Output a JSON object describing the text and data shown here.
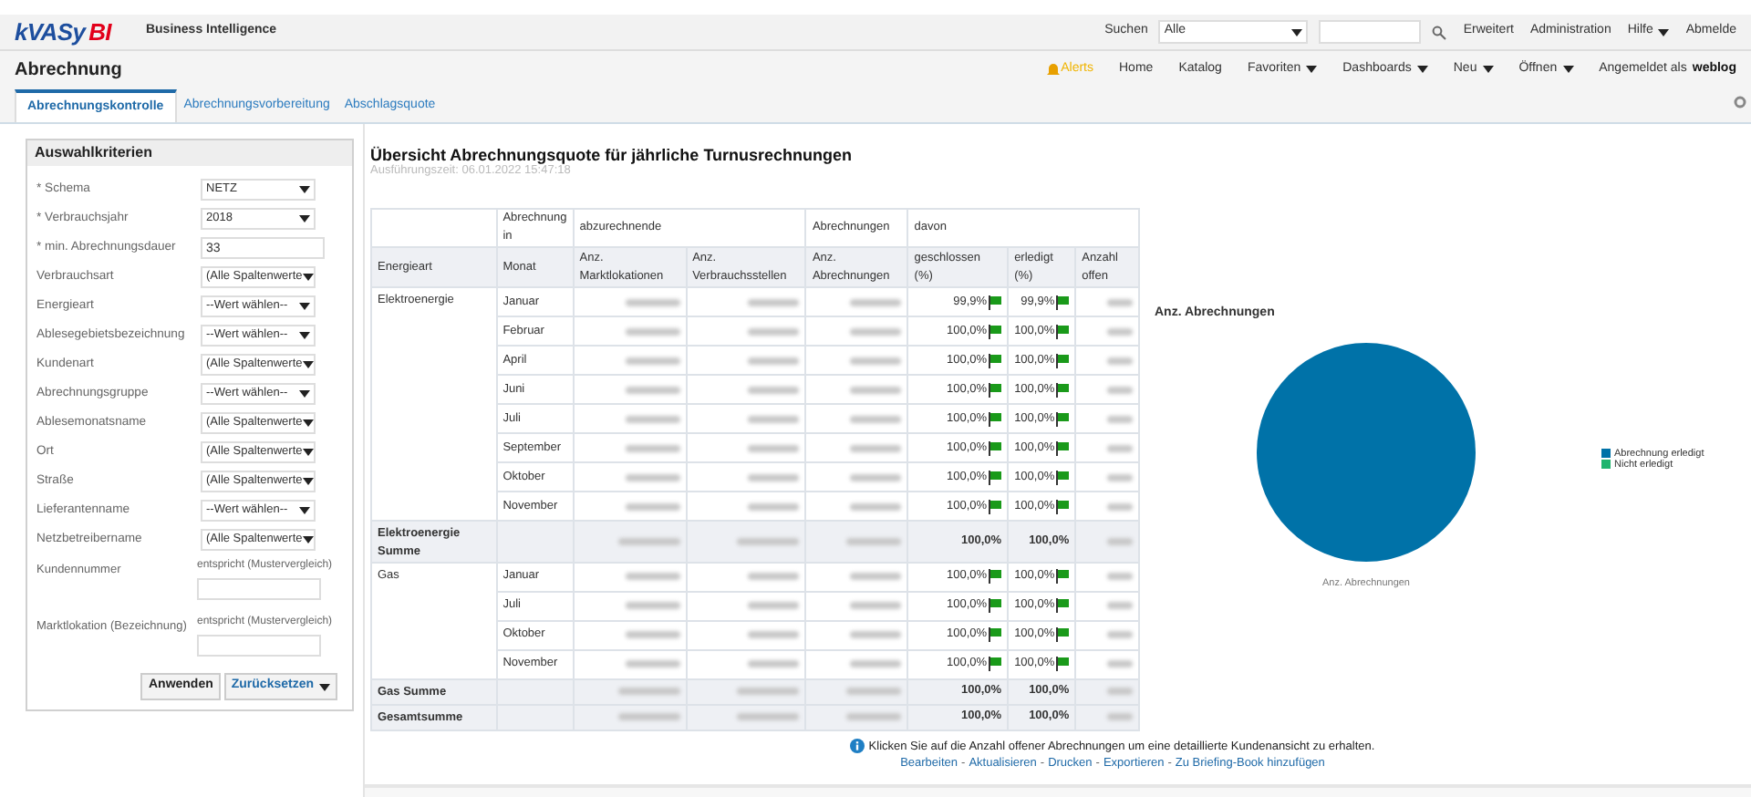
{
  "header": {
    "logo_primary": "kVASy",
    "logo_accent": "BI",
    "app_title": "Business Intelligence",
    "search": {
      "label": "Suchen",
      "scope": "Alle"
    },
    "links": [
      {
        "label": "Erweitert",
        "dropdown": false
      },
      {
        "label": "Administration",
        "dropdown": false
      },
      {
        "label": "Hilfe",
        "dropdown": true
      },
      {
        "label": "Abmelde",
        "dropdown": false
      }
    ]
  },
  "navbar": {
    "page_title": "Abrechnung",
    "alerts": "Alerts",
    "items": [
      {
        "label": "Home",
        "dropdown": false
      },
      {
        "label": "Katalog",
        "dropdown": false
      },
      {
        "label": "Favoriten",
        "dropdown": true
      },
      {
        "label": "Dashboards",
        "dropdown": true
      },
      {
        "label": "Neu",
        "dropdown": true
      },
      {
        "label": "Öffnen",
        "dropdown": true
      }
    ],
    "signed_in_label": "Angemeldet als",
    "user": "weblog"
  },
  "tabs": [
    {
      "label": "Abrechnungskontrolle",
      "selected": true
    },
    {
      "label": "Abrechnungsvorbereitung",
      "selected": false
    },
    {
      "label": "Abschlagsquote",
      "selected": false
    }
  ],
  "criteria": {
    "title": "Auswahlkriterien",
    "fields": [
      {
        "kind": "select",
        "label": "* Schema",
        "value": "NETZ"
      },
      {
        "kind": "select",
        "label": "* Verbrauchsjahr",
        "value": "2018"
      },
      {
        "kind": "text",
        "label": "* min. Abrechnungsdauer",
        "value": "33"
      },
      {
        "kind": "select",
        "label": "Verbrauchsart",
        "value": "(Alle Spaltenwerte"
      },
      {
        "kind": "select",
        "label": "Energieart",
        "value": "--Wert wählen--"
      },
      {
        "kind": "select",
        "label": "Ablesegebietsbezeichnung",
        "value": "--Wert wählen--"
      },
      {
        "kind": "select",
        "label": "Kundenart",
        "value": "(Alle Spaltenwerte"
      },
      {
        "kind": "select",
        "label": "Abrechnungsgruppe",
        "value": "--Wert wählen--"
      },
      {
        "kind": "select",
        "label": "Ablesemonatsname",
        "value": "(Alle Spaltenwerte"
      },
      {
        "kind": "select",
        "label": "Ort",
        "value": "(Alle Spaltenwerte"
      },
      {
        "kind": "select",
        "label": "Straße",
        "value": "(Alle Spaltenwerte"
      },
      {
        "kind": "select",
        "label": "Lieferantenname",
        "value": "--Wert wählen--"
      },
      {
        "kind": "select",
        "label": "Netzbetreibername",
        "value": "(Alle Spaltenwerte"
      },
      {
        "kind": "pattern",
        "label": "Kundennummer",
        "operator": "entspricht (Mustervergleich)"
      },
      {
        "kind": "pattern",
        "label": "Marktlokation (Bezeichnung)",
        "operator": "entspricht (Mustervergleich)"
      }
    ],
    "buttons": [
      {
        "label": "Anwenden",
        "dropdown": false
      },
      {
        "label": "Zurücksetzen",
        "dropdown": true
      }
    ]
  },
  "report": {
    "title": "Übersicht Abrechnungsquote für jährliche Turnusrechnungen",
    "timestamp": "Ausführungszeit: 06.01.2022 15:47:18",
    "group_headers": [
      "Abrechnung in",
      "abzurechnende",
      "Abrechnungen",
      "davon"
    ],
    "columns": [
      "Energieart",
      "Monat",
      "Anz. Marktlokationen",
      "Anz. Verbrauchsstellen",
      "Anz. Abrechnungen",
      "geschlossen (%)",
      "erledigt (%)",
      "Anzahl offen"
    ],
    "rows": [
      {
        "kind": "data",
        "energieart": "Elektroenergie",
        "monat": "Januar",
        "geschlossen": "99,9%",
        "erledigt": "99,9%",
        "flag": true
      },
      {
        "kind": "data",
        "monat": "Februar",
        "geschlossen": "100,0%",
        "erledigt": "100,0%",
        "flag": true
      },
      {
        "kind": "data",
        "monat": "April",
        "geschlossen": "100,0%",
        "erledigt": "100,0%",
        "flag": true
      },
      {
        "kind": "data",
        "monat": "Juni",
        "geschlossen": "100,0%",
        "erledigt": "100,0%",
        "flag": true
      },
      {
        "kind": "data",
        "monat": "Juli",
        "geschlossen": "100,0%",
        "erledigt": "100,0%",
        "flag": true
      },
      {
        "kind": "data",
        "monat": "September",
        "geschlossen": "100,0%",
        "erledigt": "100,0%",
        "flag": true
      },
      {
        "kind": "data",
        "monat": "Oktober",
        "geschlossen": "100,0%",
        "erledigt": "100,0%",
        "flag": true
      },
      {
        "kind": "data",
        "monat": "November",
        "geschlossen": "100,0%",
        "erledigt": "100,0%",
        "flag": true
      },
      {
        "kind": "subtotal",
        "energieart": "Elektroenergie Summe",
        "geschlossen": "100,0%",
        "erledigt": "100,0%",
        "flag": false
      },
      {
        "kind": "data",
        "energieart": "Gas",
        "monat": "Januar",
        "geschlossen": "100,0%",
        "erledigt": "100,0%",
        "flag": true
      },
      {
        "kind": "data",
        "monat": "Juli",
        "geschlossen": "100,0%",
        "erledigt": "100,0%",
        "flag": true
      },
      {
        "kind": "data",
        "monat": "Oktober",
        "geschlossen": "100,0%",
        "erledigt": "100,0%",
        "flag": true
      },
      {
        "kind": "data",
        "monat": "November",
        "geschlossen": "100,0%",
        "erledigt": "100,0%",
        "flag": true
      },
      {
        "kind": "subtotal",
        "energieart": "Gas Summe",
        "geschlossen": "100,0%",
        "erledigt": "100,0%",
        "flag": false
      },
      {
        "kind": "subtotal",
        "energieart": "Gesamtsumme",
        "geschlossen": "100,0%",
        "erledigt": "100,0%",
        "flag": false
      }
    ],
    "note": "Klicken Sie auf die Anzahl offener Abrechnungen um eine detaillierte Kundenansicht zu erhalten.",
    "links": [
      "Bearbeiten",
      "Aktualisieren",
      "Drucken",
      "Exportieren",
      "Zu Briefing-Book hinzufügen"
    ],
    "link_separator": "-"
  },
  "chart": {
    "title": "Anz. Abrechnungen",
    "caption": "Anz. Abrechnungen",
    "legend": [
      {
        "label": "Abrechnung erledigt",
        "color": "#0072a8"
      },
      {
        "label": "Nicht erledigt",
        "color": "#1fb46e"
      }
    ]
  }
}
